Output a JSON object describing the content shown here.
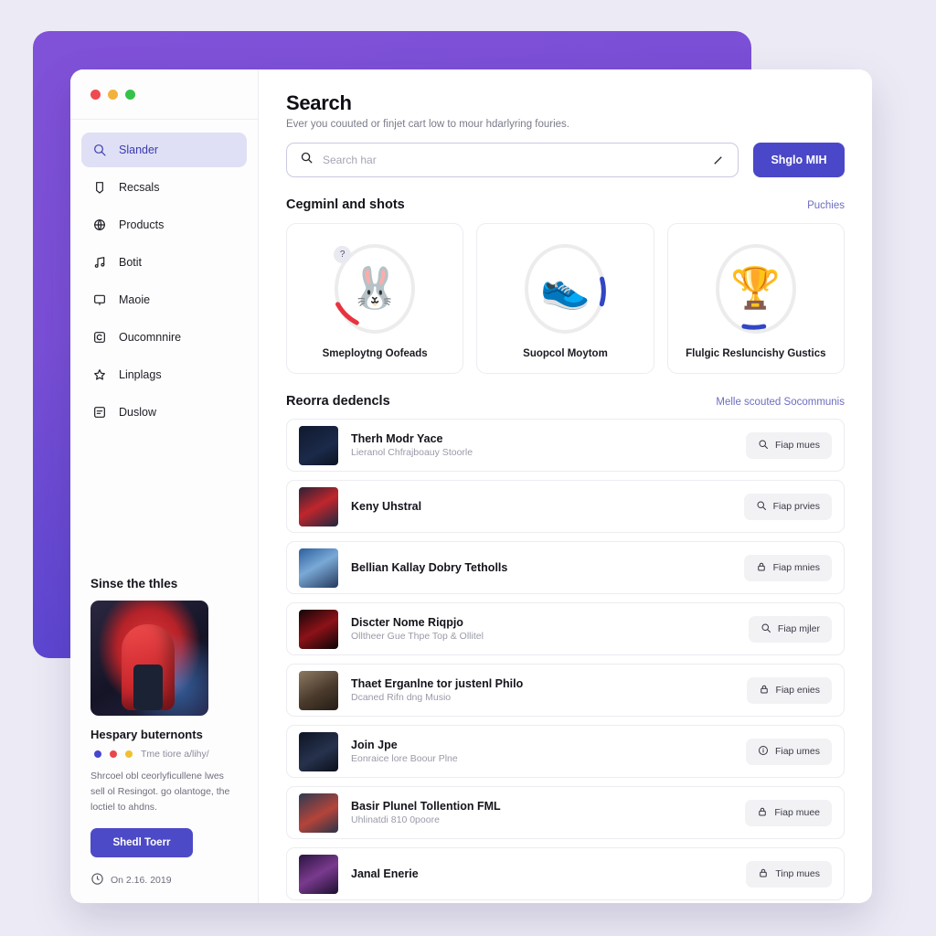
{
  "window": {
    "traffic_lights": [
      "close",
      "minimize",
      "maximize"
    ]
  },
  "sidebar": {
    "items": [
      {
        "label": "Slander",
        "icon": "search-icon",
        "active": true
      },
      {
        "label": "Recsals",
        "icon": "tag-icon",
        "active": false
      },
      {
        "label": "Products",
        "icon": "globe-icon",
        "active": false
      },
      {
        "label": "Botit",
        "icon": "music-icon",
        "active": false
      },
      {
        "label": "Maoie",
        "icon": "window-icon",
        "active": false
      },
      {
        "label": "Oucomnnire",
        "icon": "copyright-icon",
        "active": false
      },
      {
        "label": "Linplags",
        "icon": "star-icon",
        "active": false
      },
      {
        "label": "Duslow",
        "icon": "list-icon",
        "active": false
      }
    ],
    "promo": {
      "title": "Sinse the thles",
      "subtitle": "Hespary buternonts",
      "meta": "Tme tiore a/lihy/",
      "body": "Shrcoel obl ceorlyficullene lwes sell ol Resingot. go olantoge, the loctiel to ahdns.",
      "button": "Shedl Toerr",
      "footer": "On 2.16. 2019"
    }
  },
  "main": {
    "title": "Search",
    "subtitle": "Ever you couuted or finjet cart low to mour hdarlyring fouries.",
    "search": {
      "value": "",
      "placeholder": "Search har"
    },
    "primary_button": "Shglo MIH",
    "cards_section": {
      "title": "Cegminl and shots",
      "link": "Puchies"
    },
    "cards": [
      {
        "label": "Smeploytng Oofeads",
        "emoji": "🐰",
        "arc_color": "#e8333f",
        "arc_start": 118,
        "arc_len": 40,
        "badge": "?"
      },
      {
        "label": "Suopcol Moytom",
        "emoji": "👟",
        "arc_color": "#3146c4",
        "arc_start": 345,
        "arc_len": 38,
        "badge": ""
      },
      {
        "label": "Flulgic Resluncishy Gustics",
        "emoji": "🏆",
        "arc_color": "#3146c4",
        "arc_start": 78,
        "arc_len": 30,
        "badge": ""
      }
    ],
    "list_section": {
      "title": "Reorra dedencls",
      "link": "Melle scouted Socommunis"
    },
    "rows": [
      {
        "title": "Therh Modr Yace",
        "sub": "Lieranol Chfrajboauy Stoorle",
        "button": "Fiap mues",
        "icon": "search-icon",
        "thumb": "dark-navy"
      },
      {
        "title": "Keny Uhstral",
        "sub": "",
        "button": "Fiap prvies",
        "icon": "search-icon",
        "thumb": "red-hood"
      },
      {
        "title": "Bellian Kallay Dobry Tetholls",
        "sub": "",
        "button": "Fiap mnies",
        "icon": "lock-icon",
        "thumb": "blue-stage"
      },
      {
        "title": "Discter Nome Riqpjo",
        "sub": "Olltheer Gue Thpe Top & Ollitel",
        "button": "Fiap mjler",
        "icon": "search-icon",
        "thumb": "red-black"
      },
      {
        "title": "Thaet Erganlne tor justenl Philo",
        "sub": "Dcaned Rifn dng Musio",
        "button": "Fiap enies",
        "icon": "lock-icon",
        "thumb": "brown-portrait"
      },
      {
        "title": "Join Jpe",
        "sub": "Eonraice lore Boour Plne",
        "button": "Fiap umes",
        "icon": "info-icon",
        "thumb": "dark-poster"
      },
      {
        "title": "Basir Plunel Tollention FML",
        "sub": "Uhlinatdi 810 0poore",
        "button": "Fiap muee",
        "icon": "lock-icon",
        "thumb": "couple"
      },
      {
        "title": "Janal Enerie",
        "sub": "",
        "button": "Tinp mues",
        "icon": "lock-icon",
        "thumb": "purple-club"
      }
    ]
  },
  "colors": {
    "backdrop_purple": "#7a4fd6",
    "accent_indigo": "#4a47c8",
    "active_nav_bg": "#dfe0f5",
    "page_bg": "#ecebf5",
    "arc_red": "#e8333f",
    "arc_blue": "#3146c4"
  }
}
